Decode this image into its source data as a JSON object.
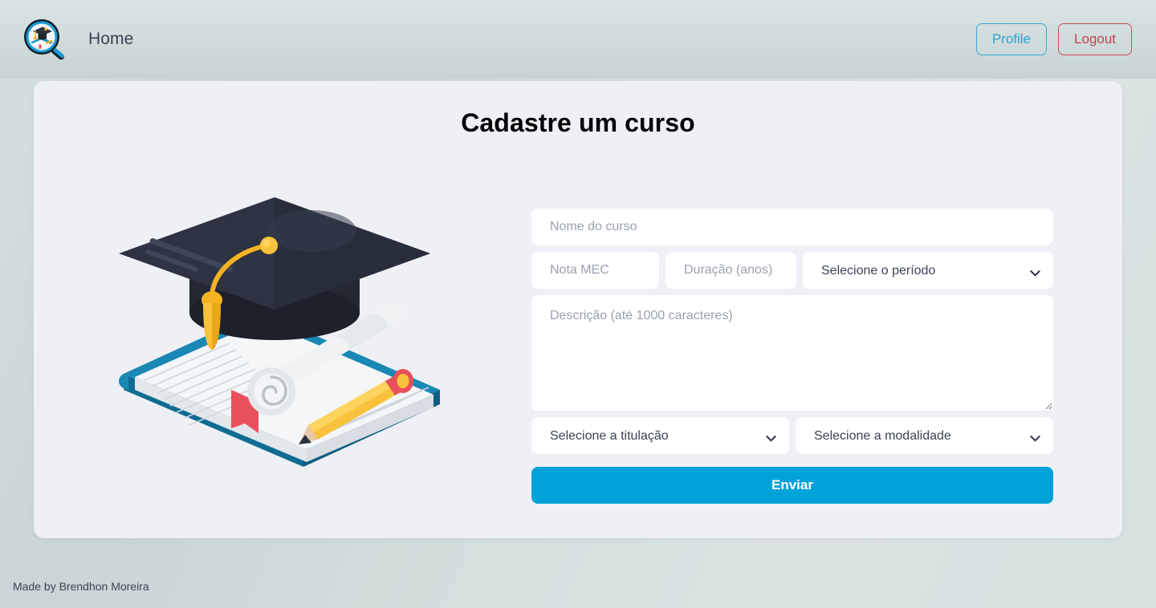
{
  "navbar": {
    "logo_icon": "magnifier-graduation-logo",
    "brand_label": "Home",
    "profile_label": "Profile",
    "logout_label": "Logout",
    "profile_color": "#36a8d8",
    "logout_color": "#ca4b58"
  },
  "card": {
    "title": "Cadastre um curso",
    "illustration_icon": "graduation-cap-book-illustration",
    "background": "#eff0f5"
  },
  "form": {
    "nome_placeholder": "Nome do curso",
    "nome_value": "",
    "nota_placeholder": "Nota MEC",
    "nota_value": "",
    "duracao_placeholder": "Duração (anos)",
    "duracao_value": "",
    "periodo_selected": "Selecione o período",
    "periodo_options": [
      "Selecione o período"
    ],
    "descricao_placeholder": "Descrição (até 1000 caracteres)",
    "descricao_value": "",
    "titulacao_selected": "Selecione a titulação",
    "titulacao_options": [
      "Selecione a titulação"
    ],
    "modalidade_selected": "Selecione a modalidade",
    "modalidade_options": [
      "Selecione a modalidade"
    ],
    "submit_label": "Enviar",
    "submit_color": "#00a3d9",
    "chevron_icon": "chevron-down-icon"
  },
  "footer": {
    "credit": "Made by Brendhon Moreira"
  }
}
